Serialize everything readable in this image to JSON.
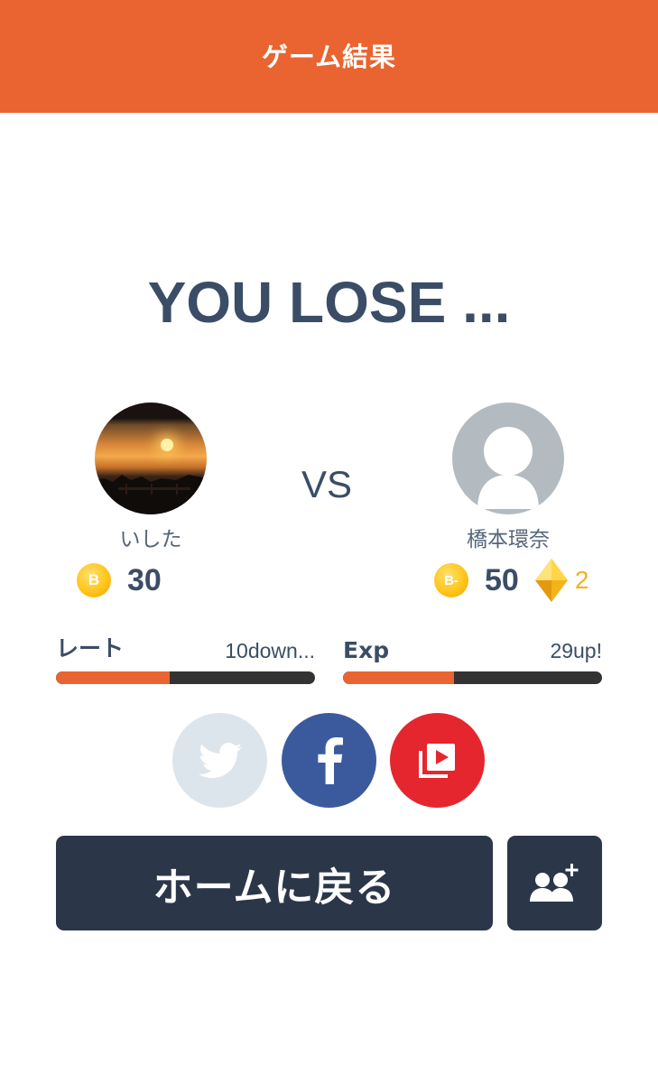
{
  "header": {
    "title": "ゲーム結果"
  },
  "result": {
    "text": "YOU LOSE ..."
  },
  "vs_text": "VS",
  "player_left": {
    "name": "いした",
    "coin_label": "B",
    "coin_value": "30"
  },
  "player_right": {
    "name": "橋本環奈",
    "coin_label": "B-",
    "coin_value": "50",
    "gem_count": "2"
  },
  "rate": {
    "label": "レート",
    "value": "10down...",
    "progress": 0.44
  },
  "exp": {
    "label": "Exp",
    "value": "29up!",
    "progress": 0.43
  },
  "share_buttons": [
    {
      "icon": "twitter-icon"
    },
    {
      "icon": "facebook-icon"
    },
    {
      "icon": "video-icon"
    }
  ],
  "home_button": {
    "label": "ホームに戻る"
  },
  "add_friend_button": {
    "icon": "add-friend-icon"
  },
  "colors": {
    "header": "#e96430",
    "text": "#3b4d66",
    "button": "#2b3649",
    "bar_fill": "#e96430",
    "bar_track": "#333333",
    "coin": "#ffc51a",
    "gem": "#f2b31b",
    "twitter": "#dde5ec",
    "facebook": "#3b5a9e",
    "video": "#e5262e"
  }
}
